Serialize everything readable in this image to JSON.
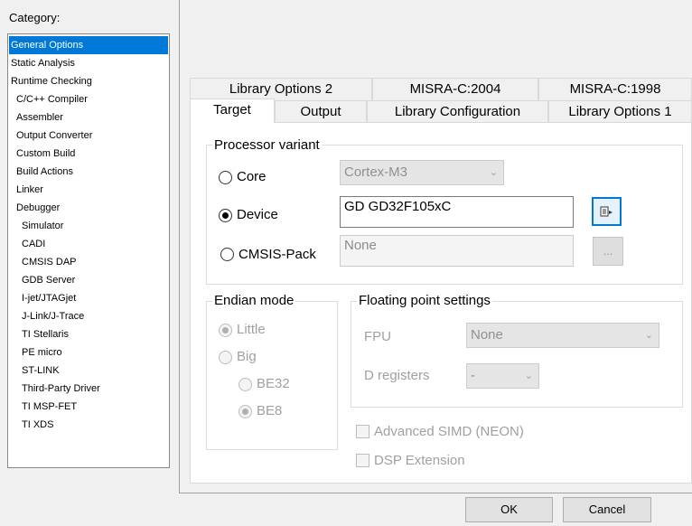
{
  "sidebar": {
    "title": "Category:",
    "items": [
      {
        "label": "General Options",
        "indent": 0,
        "selected": true
      },
      {
        "label": "Static Analysis",
        "indent": 0
      },
      {
        "label": "Runtime Checking",
        "indent": 0
      },
      {
        "label": "C/C++ Compiler",
        "indent": 1
      },
      {
        "label": "Assembler",
        "indent": 1
      },
      {
        "label": "Output Converter",
        "indent": 1
      },
      {
        "label": "Custom Build",
        "indent": 1
      },
      {
        "label": "Build Actions",
        "indent": 1
      },
      {
        "label": "Linker",
        "indent": 1
      },
      {
        "label": "Debugger",
        "indent": 1
      },
      {
        "label": "Simulator",
        "indent": 2
      },
      {
        "label": "CADI",
        "indent": 2
      },
      {
        "label": "CMSIS DAP",
        "indent": 2
      },
      {
        "label": "GDB Server",
        "indent": 2
      },
      {
        "label": "I-jet/JTAGjet",
        "indent": 2
      },
      {
        "label": "J-Link/J-Trace",
        "indent": 2
      },
      {
        "label": "TI Stellaris",
        "indent": 2
      },
      {
        "label": "PE micro",
        "indent": 2
      },
      {
        "label": "ST-LINK",
        "indent": 2
      },
      {
        "label": "Third-Party Driver",
        "indent": 2
      },
      {
        "label": "TI MSP-FET",
        "indent": 2
      },
      {
        "label": "TI XDS",
        "indent": 2
      }
    ]
  },
  "tabs": {
    "row1": [
      "Library Options 2",
      "MISRA-C:2004",
      "MISRA-C:1998"
    ],
    "row2": [
      "Target",
      "Output",
      "Library Configuration",
      "Library Options 1"
    ],
    "active": "Target"
  },
  "processor": {
    "title": "Processor variant",
    "core_label": "Core",
    "core_value": "Cortex-M3",
    "device_label": "Device",
    "device_value": "GD GD32F105xC",
    "cmsis_label": "CMSIS-Pack",
    "cmsis_value": "None",
    "browse_label": "...",
    "selected": "Device"
  },
  "endian": {
    "title": "Endian mode",
    "little": "Little",
    "big": "Big",
    "be32": "BE32",
    "be8": "BE8"
  },
  "fpu": {
    "title": "Floating point settings",
    "fpu_label": "FPU",
    "fpu_value": "None",
    "dreg_label": "D registers",
    "dreg_value": "-"
  },
  "options": {
    "neon": "Advanced SIMD (NEON)",
    "dsp": "DSP Extension"
  },
  "buttons": {
    "ok": "OK",
    "cancel": "Cancel"
  },
  "icons": {
    "device_select": "device-select-icon",
    "combo_arrow": "chevron-down-icon"
  },
  "colors": {
    "selection": "#0078d7"
  }
}
